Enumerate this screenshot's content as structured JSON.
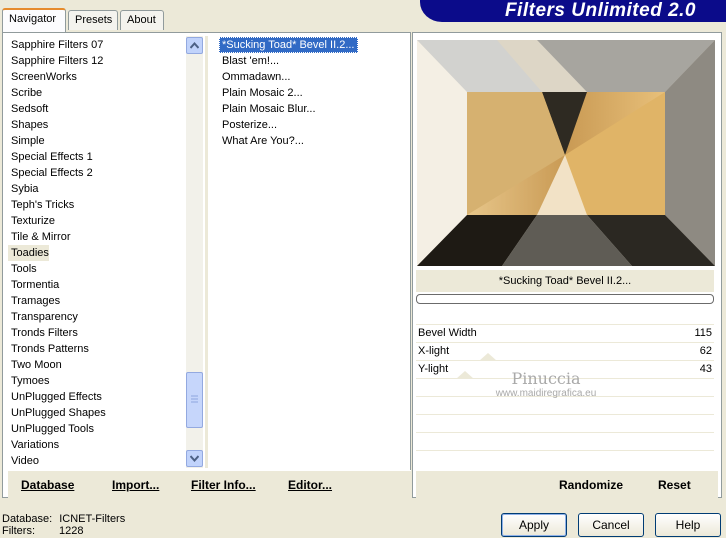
{
  "tabs": [
    {
      "label": "Navigator"
    },
    {
      "label": "Presets"
    },
    {
      "label": "About"
    }
  ],
  "banner": {
    "title": "Filters Unlimited 2.0"
  },
  "categories": [
    "Sapphire Filters 07",
    "Sapphire Filters 12",
    "ScreenWorks",
    "Scribe",
    "Sedsoft",
    "Shapes",
    "Simple",
    "Special Effects 1",
    "Special Effects 2",
    "Sybia",
    "Teph's Tricks",
    "Texturize",
    "Tile & Mirror",
    "Toadies",
    "Tools",
    "Tormentia",
    "Tramages",
    "Transparency",
    "Tronds Filters",
    "Tronds Patterns",
    "Two Moon",
    "Tymoes",
    "UnPlugged Effects",
    "UnPlugged Shapes",
    "UnPlugged Tools",
    "Variations",
    "Video"
  ],
  "selected_category": "Toadies",
  "filters": [
    "*Sucking Toad*  Bevel II.2...",
    "Blast 'em!...",
    "Ommadawn...",
    "Plain Mosaic 2...",
    "Plain Mosaic Blur...",
    "Posterize...",
    "What Are You?..."
  ],
  "selected_filter": "*Sucking Toad*  Bevel II.2...",
  "preview": {
    "filter_name": "*Sucking Toad*  Bevel II.2..."
  },
  "params": [
    {
      "label": "Bevel Width",
      "value": "115"
    },
    {
      "label": "X-light",
      "value": "62"
    },
    {
      "label": "Y-light",
      "value": "43"
    }
  ],
  "watermark": {
    "name": "Pinuccia",
    "url": "www.maidiregrafica.eu"
  },
  "left_buttons": {
    "database": "Database",
    "import": "Import...",
    "filter_info": "Filter Info...",
    "editor": "Editor..."
  },
  "right_buttons": {
    "randomize": "Randomize",
    "reset": "Reset"
  },
  "status": {
    "database_label": "Database:",
    "database_value": "ICNET-Filters",
    "filters_label": "Filters:",
    "filters_value": "1228"
  },
  "dialog_buttons": {
    "apply": "Apply",
    "cancel": "Cancel",
    "help": "Help"
  },
  "colors": {
    "selection": "#316ac5",
    "banner": "#0b0b8a",
    "accent_tab": "#e68b2c"
  }
}
